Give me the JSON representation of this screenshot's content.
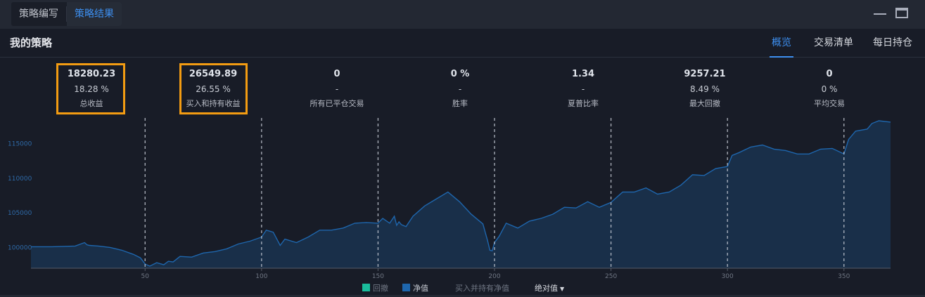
{
  "tabs": [
    "策略编写",
    "策略结果"
  ],
  "header": {
    "title": "我的策略",
    "tabs": [
      "概览",
      "交易清单",
      "每日持仓"
    ]
  },
  "stats": [
    {
      "value": "18280.23",
      "sub": "18.28 %",
      "label": "总收益"
    },
    {
      "value": "26549.89",
      "sub": "26.55 %",
      "label": "买入和持有收益"
    },
    {
      "value": "0",
      "sub": "-",
      "label": "所有已平仓交易"
    },
    {
      "value": "0 %",
      "sub": "-",
      "label": "胜率"
    },
    {
      "value": "1.34",
      "sub": "-",
      "label": "夏普比率"
    },
    {
      "value": "9257.21",
      "sub": "8.49 %",
      "label": "最大回撤"
    },
    {
      "value": "0",
      "sub": "0 %",
      "label": "平均交易"
    }
  ],
  "legend": {
    "drawdown": "回撤",
    "nav": "净值",
    "buyhold": "买入并持有净值",
    "mode": "绝对值"
  },
  "colors": {
    "accent": "#3d8ff0",
    "highlight": "#f39c12",
    "line": "#1e66ad",
    "fill": "#1a3350",
    "drawdown": "#1abc9c"
  },
  "chart_data": {
    "type": "area",
    "x_ticks": [
      50,
      100,
      150,
      200,
      250,
      300,
      350
    ],
    "y_ticks": [
      100000,
      105000,
      110000,
      115000
    ],
    "xlim": [
      1,
      370
    ],
    "ylim": [
      97000,
      118500
    ],
    "dashed_x": [
      50,
      100,
      150,
      200,
      250,
      300,
      350
    ],
    "series": [
      {
        "name": "净值",
        "x": [
          1,
          10,
          20,
          24,
          25,
          26,
          30,
          35,
          40,
          45,
          48,
          50,
          52,
          55,
          58,
          60,
          62,
          65,
          70,
          75,
          80,
          85,
          90,
          95,
          100,
          102,
          105,
          108,
          110,
          115,
          120,
          125,
          130,
          135,
          140,
          145,
          150,
          152,
          155,
          157,
          158,
          159,
          160,
          162,
          165,
          170,
          175,
          180,
          185,
          190,
          195,
          197,
          198,
          199,
          200,
          202,
          205,
          210,
          215,
          220,
          225,
          230,
          235,
          240,
          245,
          250,
          255,
          260,
          265,
          270,
          275,
          280,
          285,
          290,
          295,
          300,
          302,
          305,
          310,
          315,
          320,
          325,
          330,
          335,
          340,
          345,
          350,
          352,
          355,
          360,
          362,
          365,
          370
        ],
        "values": [
          100100,
          100100,
          100200,
          100700,
          100400,
          100300,
          100200,
          100000,
          99600,
          99000,
          98500,
          97600,
          97300,
          97800,
          97500,
          98000,
          97900,
          98700,
          98600,
          99200,
          99400,
          99800,
          100500,
          100900,
          101500,
          102500,
          102200,
          100300,
          101200,
          100700,
          101500,
          102500,
          102500,
          102800,
          103500,
          103600,
          103500,
          104200,
          103500,
          104500,
          103200,
          103700,
          103300,
          103000,
          104500,
          106000,
          107000,
          108000,
          106600,
          104800,
          103400,
          101000,
          99600,
          99500,
          100700,
          101600,
          103500,
          102800,
          103800,
          104200,
          104800,
          105800,
          105700,
          106600,
          105800,
          106500,
          108000,
          108000,
          108600,
          107700,
          108000,
          109000,
          110500,
          110400,
          111400,
          111700,
          113300,
          113700,
          114500,
          114800,
          114200,
          114000,
          113500,
          113500,
          114200,
          114300,
          113500,
          115600,
          116800,
          117100,
          117900,
          118300,
          118100
        ]
      }
    ]
  }
}
